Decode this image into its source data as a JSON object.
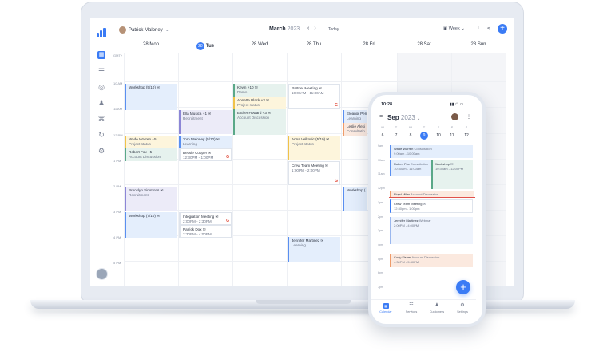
{
  "colors": {
    "accent": "#3a7bf5",
    "blue": "#e4eefc",
    "green": "#e6f2ee",
    "purple": "#ecebf8",
    "yellow": "#fdf5dc",
    "orange": "#fbe9df"
  },
  "desktop": {
    "user_name": "Patrick Maloney",
    "month": "March",
    "year": "2023",
    "today_label": "Today",
    "view_label": "Week",
    "days": [
      {
        "num": "28",
        "name": "Mon"
      },
      {
        "num": "28",
        "name": "Tue",
        "today": true
      },
      {
        "num": "28",
        "name": "Wed"
      },
      {
        "num": "28",
        "name": "Thu"
      },
      {
        "num": "28",
        "name": "Fri"
      },
      {
        "num": "28",
        "name": "Sat"
      },
      {
        "num": "28",
        "name": "Sun"
      }
    ],
    "time_labels": [
      "GMT+",
      "10 AM",
      "11 AM",
      "12 PM",
      "1 PM",
      "2 PM",
      "3 PM",
      "4 PM",
      "5 PM"
    ],
    "events": {
      "workshop_mon": {
        "name": "Workshop (5/10) ✉",
        "sub": ""
      },
      "wade_mon": {
        "name": "Wade Warren +5",
        "sub": "Project status"
      },
      "robert_mon": {
        "name": "Robert Fox +5",
        "sub": "Account Discussion"
      },
      "brooklyn_mon": {
        "name": "Brooklyn Simmons ✉",
        "sub": "Recruitment"
      },
      "workshop2_mon": {
        "name": "Workshop (7/10) ✉",
        "sub": ""
      },
      "ella_tue": {
        "name": "Ella Musica +1 ✉",
        "sub": "Recruitment"
      },
      "tom_tue": {
        "name": "Tom Maloney (5/10) ✉",
        "sub": "Learning"
      },
      "bessie_tue": {
        "name": "Bessie Cooper ✉",
        "sub": "12:30PM - 1:00PM"
      },
      "integration_tue": {
        "name": "Integration Meeting ✉",
        "sub": "2:00PM - 2:30PM"
      },
      "patrick_tue": {
        "name": "Patrick Dox ✉",
        "sub": "2:30PM - 4:00PM"
      },
      "kevin_wed": {
        "name": "Kevin +10 ✉",
        "sub": "Demo"
      },
      "annette_wed": {
        "name": "Annette Black +3 ✉",
        "sub": "Project status"
      },
      "esther_wed": {
        "name": "Esther Howard +3 ✉",
        "sub": "Account Discussion"
      },
      "jennifer_wed": {
        "name": "Jennifer Martinez ✉",
        "sub": "Learning"
      },
      "partner_thu": {
        "name": "Partner Meeting ✉",
        "sub": "10:00AM - 11:30AM"
      },
      "anna_thu": {
        "name": "Anna Velkovic (5/10) ✉",
        "sub": "Project status"
      },
      "crew_thu": {
        "name": "Crew Team Meeting ✉",
        "sub": "1:00PM - 2:00PM"
      },
      "eleanor_fri": {
        "name": "Eleanor Pen",
        "sub": "Learning"
      },
      "leslie_fri": {
        "name": "Leslie Alexi",
        "sub": "Consultatio"
      },
      "workshop_fri": {
        "name": "Workshop (",
        "sub": ""
      }
    },
    "google_glyph": "G"
  },
  "phone": {
    "time": "10:28",
    "month": "Sep",
    "year": "2023",
    "weekdays": [
      "M",
      "T",
      "W",
      "T",
      "F",
      "S",
      "S"
    ],
    "dates": [
      "6",
      "7",
      "8",
      "9",
      "10",
      "11",
      "12"
    ],
    "selected_date": "9",
    "time_labels": [
      "9am",
      "10am",
      "11am",
      "12pm",
      "1pm",
      "2pm",
      "3pm",
      "4pm",
      "5pm",
      "6pm",
      "7pm"
    ],
    "events": {
      "wade": {
        "name": "Wade Warren",
        "type": "Consultation",
        "time": "9:00am - 10:00am"
      },
      "robert": {
        "name": "Robert Fox",
        "type": "Consultation",
        "time": "10:30am - 11:00am"
      },
      "workshop": {
        "name": "Workshop",
        "type": "✉",
        "time": "10:30am - 12:00PM"
      },
      "floyd": {
        "name": "Floyd Miles",
        "type": "Account Discussion",
        "time": ""
      },
      "crew": {
        "name": "Crew Team Meeting",
        "type": "✉",
        "time": "12:30pm - 1:00pm"
      },
      "jennifer": {
        "name": "Jennifer Martinez",
        "type": "Webinar",
        "time": "2:00PM - 4:00PM"
      },
      "cody": {
        "name": "Cody Fisher",
        "type": "Account Discussion",
        "time": "4:30PM - 5:30PM"
      }
    },
    "tabs": [
      {
        "label": "Calendar",
        "active": true
      },
      {
        "label": "Services"
      },
      {
        "label": "Customers"
      },
      {
        "label": "Settings"
      }
    ]
  }
}
